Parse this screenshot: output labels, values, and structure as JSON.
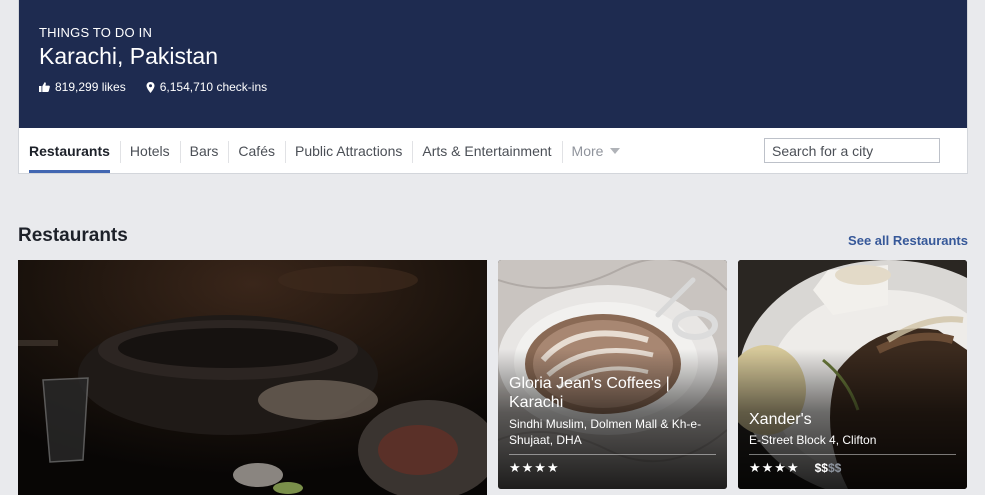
{
  "header": {
    "eyebrow": "THINGS TO DO IN",
    "city": "Karachi, Pakistan",
    "likes": "819,299 likes",
    "checkins": "6,154,710 check-ins",
    "hero_color": "#1e2b50"
  },
  "tabs": [
    {
      "label": "Restaurants",
      "active": true
    },
    {
      "label": "Hotels"
    },
    {
      "label": "Bars"
    },
    {
      "label": "Cafés"
    },
    {
      "label": "Public Attractions"
    },
    {
      "label": "Arts & Entertainment"
    },
    {
      "label": "More"
    }
  ],
  "search": {
    "placeholder": "Search for a city"
  },
  "section": {
    "title": "Restaurants",
    "see_all": "See all Restaurants"
  },
  "cards": [
    {
      "name": "Gloria Jean's Coffees | Karachi",
      "address": "Sindhi Muslim, Dolmen Mall & Kh-e-Shujaat, DHA",
      "stars": "★★★★"
    },
    {
      "name": "Xander's",
      "address": "E-Street Block 4, Clifton",
      "stars": "★★★★",
      "price_active": "$$",
      "price_inactive": "$$"
    }
  ],
  "colors": {
    "accent": "#4267b2",
    "link": "#365899"
  }
}
